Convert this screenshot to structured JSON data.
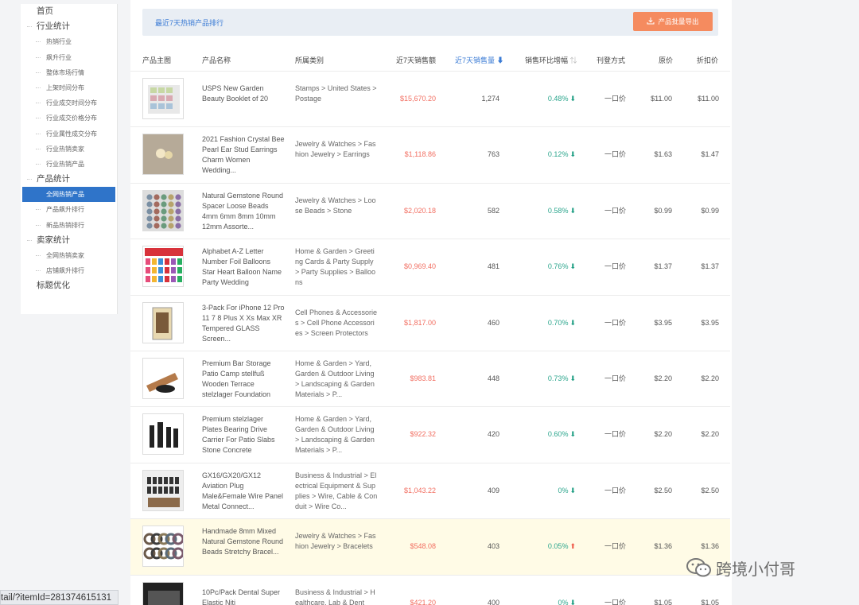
{
  "sidebar": {
    "items": [
      {
        "label": "首页",
        "level": 1,
        "group": false,
        "active": false
      },
      {
        "label": "行业统计",
        "level": 1,
        "group": true,
        "active": false
      },
      {
        "label": "热销行业",
        "level": 2,
        "active": false
      },
      {
        "label": "飙升行业",
        "level": 2,
        "active": false
      },
      {
        "label": "整体市场行情",
        "level": 2,
        "active": false
      },
      {
        "label": "上架时间分布",
        "level": 2,
        "active": false
      },
      {
        "label": "行业成交时间分布",
        "level": 2,
        "active": false
      },
      {
        "label": "行业成交价格分布",
        "level": 2,
        "active": false
      },
      {
        "label": "行业属性成交分布",
        "level": 2,
        "active": false
      },
      {
        "label": "行业热销卖家",
        "level": 2,
        "active": false
      },
      {
        "label": "行业热销产品",
        "level": 2,
        "active": false
      },
      {
        "label": "产品统计",
        "level": 1,
        "group": true,
        "active": false
      },
      {
        "label": "全网热销产品",
        "level": 2,
        "active": true
      },
      {
        "label": "产品飙升排行",
        "level": 2,
        "active": false
      },
      {
        "label": "新品热销排行",
        "level": 2,
        "active": false
      },
      {
        "label": "卖家统计",
        "level": 1,
        "group": true,
        "active": false
      },
      {
        "label": "全网热销卖家",
        "level": 2,
        "active": false
      },
      {
        "label": "店铺飙升排行",
        "level": 2,
        "active": false
      },
      {
        "label": "标题优化",
        "level": 1,
        "group": false,
        "active": false
      }
    ]
  },
  "banner": {
    "title": "最近7天热销产品排行",
    "export_label": "产品批量导出"
  },
  "table": {
    "headers": {
      "image": "产品主图",
      "name": "产品名称",
      "category": "所属类别",
      "sales": "近7天销售额",
      "volume": "近7天销售量",
      "growth": "销售环比增幅",
      "mode": "刊登方式",
      "orig": "原价",
      "disc": "折扣价"
    },
    "rows": [
      {
        "name": "USPS New Garden Beauty Booklet of 20",
        "category": "Stamps > United States > Postage",
        "sales": "$15,670.20",
        "volume": "1,274",
        "growth": "0.48%",
        "dir": "down",
        "mode": "一口价",
        "orig": "$11.00",
        "disc": "$11.00"
      },
      {
        "name": "2021 Fashion Crystal Bee Pearl Ear Stud Earrings Charm Women Wedding...",
        "category": "Jewelry & Watches > Fashion Jewelry > Earrings",
        "sales": "$1,118.86",
        "volume": "763",
        "growth": "0.12%",
        "dir": "down",
        "mode": "一口价",
        "orig": "$1.63",
        "disc": "$1.47"
      },
      {
        "name": "Natural Gemstone Round Spacer Loose Beads 4mm 6mm 8mm 10mm 12mm Assorte...",
        "category": "Jewelry & Watches > Loose Beads > Stone",
        "sales": "$2,020.18",
        "volume": "582",
        "growth": "0.58%",
        "dir": "down",
        "mode": "一口价",
        "orig": "$0.99",
        "disc": "$0.99"
      },
      {
        "name": "Alphabet A-Z Letter Number Foil Balloons Star Heart Balloon Name Party Wedding",
        "category": "Home & Garden > Greeting Cards & Party Supply > Party Supplies > Balloons",
        "sales": "$0,969.40",
        "volume": "481",
        "growth": "0.76%",
        "dir": "down",
        "mode": "一口价",
        "orig": "$1.37",
        "disc": "$1.37"
      },
      {
        "name": "3-Pack For iPhone 12 Pro 11 7 8 Plus X Xs Max XR Tempered GLASS Screen...",
        "category": "Cell Phones & Accessories > Cell Phone Accessories > Screen Protectors",
        "sales": "$1,817.00",
        "volume": "460",
        "growth": "0.70%",
        "dir": "down",
        "mode": "一口价",
        "orig": "$3.95",
        "disc": "$3.95"
      },
      {
        "name": "Premium Bar Storage Patio Camp stellfuß Wooden Terrace stelzlager Foundation",
        "category": "Home & Garden > Yard, Garden & Outdoor Living > Landscaping & Garden Materials > P...",
        "sales": "$983.81",
        "volume": "448",
        "growth": "0.73%",
        "dir": "down",
        "mode": "一口价",
        "orig": "$2.20",
        "disc": "$2.20"
      },
      {
        "name": "Premium stelzlager Plates Bearing Drive Carrier For Patio Slabs Stone Concrete",
        "category": "Home & Garden > Yard, Garden & Outdoor Living > Landscaping & Garden Materials > P...",
        "sales": "$922.32",
        "volume": "420",
        "growth": "0.60%",
        "dir": "down",
        "mode": "一口价",
        "orig": "$2.20",
        "disc": "$2.20"
      },
      {
        "name": "GX16/GX20/GX12 Aviation Plug Male&Female Wire Panel Metal Connect...",
        "category": "Business & Industrial > Electrical Equipment & Supplies > Wire, Cable & Conduit > Wire Co...",
        "sales": "$1,043.22",
        "volume": "409",
        "growth": "0%",
        "dir": "down",
        "mode": "一口价",
        "orig": "$2.50",
        "disc": "$2.50"
      },
      {
        "name": "Handmade 8mm Mixed Natural Gemstone Round Beads Stretchy Bracel...",
        "category": "Jewelry & Watches > Fashion Jewelry > Bracelets",
        "sales": "$548.08",
        "volume": "403",
        "growth": "0.05%",
        "dir": "up",
        "mode": "一口价",
        "orig": "$1.36",
        "disc": "$1.36"
      },
      {
        "name": "10Pc/Pack Dental Super Elastic Niti",
        "category": "Business & Industrial > Healthcare, Lab & Dent",
        "sales": "$421.20",
        "volume": "400",
        "growth": "0%",
        "dir": "down",
        "mode": "一口价",
        "orig": "$1.05",
        "disc": "$1.05"
      }
    ]
  },
  "status_url": "tail/?itemId=281374615131",
  "watermark": "跨境小付哥",
  "colors": {
    "accent": "#2f74c9",
    "export": "#f58b5f",
    "sales": "#f26f62",
    "growth": "#2aa58c",
    "highlight_row": "#fffbe6"
  }
}
